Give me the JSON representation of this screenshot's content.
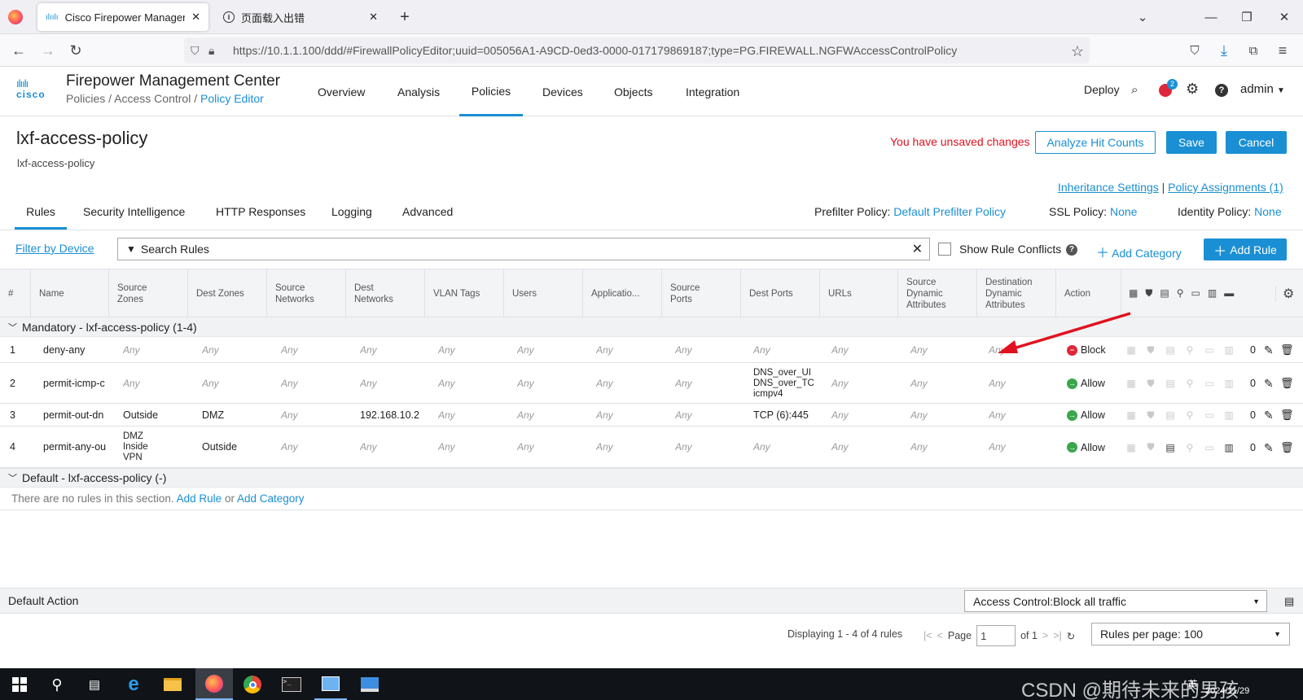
{
  "browser": {
    "tabs": [
      {
        "label": "Cisco Firepower Managemen"
      },
      {
        "label": "页面载入出错"
      }
    ],
    "url": "https://10.1.1.100/ddd/#FirewallPolicyEditor;uuid=005056A1-A9CD-0ed3-0000-017179869187;type=PG.FIREWALL.NGFWAccessControlPolicy"
  },
  "app": {
    "logo_text": "cisco",
    "title": "Firepower Management Center",
    "breadcrumb": {
      "part1": "Policies",
      "sep": " / ",
      "part2": "Access Control",
      "part3": "Policy Editor"
    },
    "nav": [
      "Overview",
      "Analysis",
      "Policies",
      "Devices",
      "Objects",
      "Integration"
    ],
    "right": {
      "deploy": "Deploy",
      "notif_count": "2",
      "user": "admin"
    }
  },
  "policy": {
    "name": "lxf-access-policy",
    "description": "lxf-access-policy",
    "unsaved": "You have unsaved changes",
    "btn_analyze": "Analyze Hit Counts",
    "btn_save": "Save",
    "btn_cancel": "Cancel",
    "inheritance": "Inheritance Settings",
    "assignments": "Policy Assignments (1)",
    "tabs": [
      "Rules",
      "Security Intelligence",
      "HTTP Responses",
      "Logging",
      "Advanced"
    ],
    "prefilter_label": "Prefilter Policy:",
    "prefilter_value": "Default Prefilter Policy",
    "ssl_label": "SSL Policy:",
    "ssl_value": "None",
    "identity_label": "Identity Policy:",
    "identity_value": "None"
  },
  "toolbar": {
    "filter_by_device": "Filter by Device",
    "search_placeholder": "Search Rules",
    "show_conflicts": "Show Rule Conflicts",
    "add_category": "Add Category",
    "add_rule": "Add Rule"
  },
  "table": {
    "headers": [
      "#",
      "Name",
      "Source\nZones",
      "Dest Zones",
      "Source\nNetworks",
      "Dest\nNetworks",
      "VLAN Tags",
      "Users",
      "Applicatio...",
      "Source\nPorts",
      "Dest Ports",
      "URLs",
      "Source\nDynamic\nAttributes",
      "Destination\nDynamic\nAttributes",
      "Action"
    ],
    "mandatory_section": "Mandatory - lxf-access-policy (1-4)",
    "default_section": "Default - lxf-access-policy (-)",
    "empty_text": "There are no rules in this section.",
    "empty_add_rule": "Add Rule",
    "empty_or": "or",
    "empty_add_category": "Add Category",
    "rows": [
      {
        "num": "1",
        "name": "deny-any",
        "src_zones": "Any",
        "dst_zones": "Any",
        "src_net": "Any",
        "dst_net": "Any",
        "vlan": "Any",
        "users": "Any",
        "apps": "Any",
        "src_ports": "Any",
        "dst_ports": "Any",
        "urls": "Any",
        "src_dyn": "Any",
        "dst_dyn": "Any",
        "action": "Block",
        "hits": "0"
      },
      {
        "num": "2",
        "name": "permit-icmp-c",
        "src_zones": "Any",
        "dst_zones": "Any",
        "src_net": "Any",
        "dst_net": "Any",
        "vlan": "Any",
        "users": "Any",
        "apps": "Any",
        "src_ports": "Any",
        "dst_ports": "DNS_over_UI\nDNS_over_TC\nicmpv4",
        "urls": "Any",
        "src_dyn": "Any",
        "dst_dyn": "Any",
        "action": "Allow",
        "hits": "0"
      },
      {
        "num": "3",
        "name": "permit-out-dn",
        "src_zones": "Outside",
        "dst_zones": "DMZ",
        "src_net": "Any",
        "dst_net": "192.168.10.2",
        "vlan": "Any",
        "users": "Any",
        "apps": "Any",
        "src_ports": "Any",
        "dst_ports": "TCP (6):445",
        "urls": "Any",
        "src_dyn": "Any",
        "dst_dyn": "Any",
        "action": "Allow",
        "hits": "0"
      },
      {
        "num": "4",
        "name": "permit-any-ou",
        "src_zones": "DMZ\nInside\nVPN",
        "dst_zones": "Outside",
        "src_net": "Any",
        "dst_net": "Any",
        "vlan": "Any",
        "users": "Any",
        "apps": "Any",
        "src_ports": "Any",
        "dst_ports": "Any",
        "urls": "Any",
        "src_dyn": "Any",
        "dst_dyn": "Any",
        "action": "Allow",
        "hits": "0"
      }
    ]
  },
  "footer": {
    "default_action_label": "Default Action",
    "default_action_value": "Access Control:Block all traffic",
    "displaying": "Displaying 1 - 4 of 4 rules",
    "page_label": "Page",
    "page_value": "1",
    "of_label": "of 1",
    "per_page": "Rules per page: 100"
  },
  "taskbar": {
    "watermark": "CSDN @期待未来的男孩",
    "date": "2024/11/29",
    "ime": "英"
  },
  "colors": {
    "accent": "#1a8fd4",
    "block": "#e0263a",
    "allow": "#3aa64c",
    "unsaved": "#e0121f"
  }
}
